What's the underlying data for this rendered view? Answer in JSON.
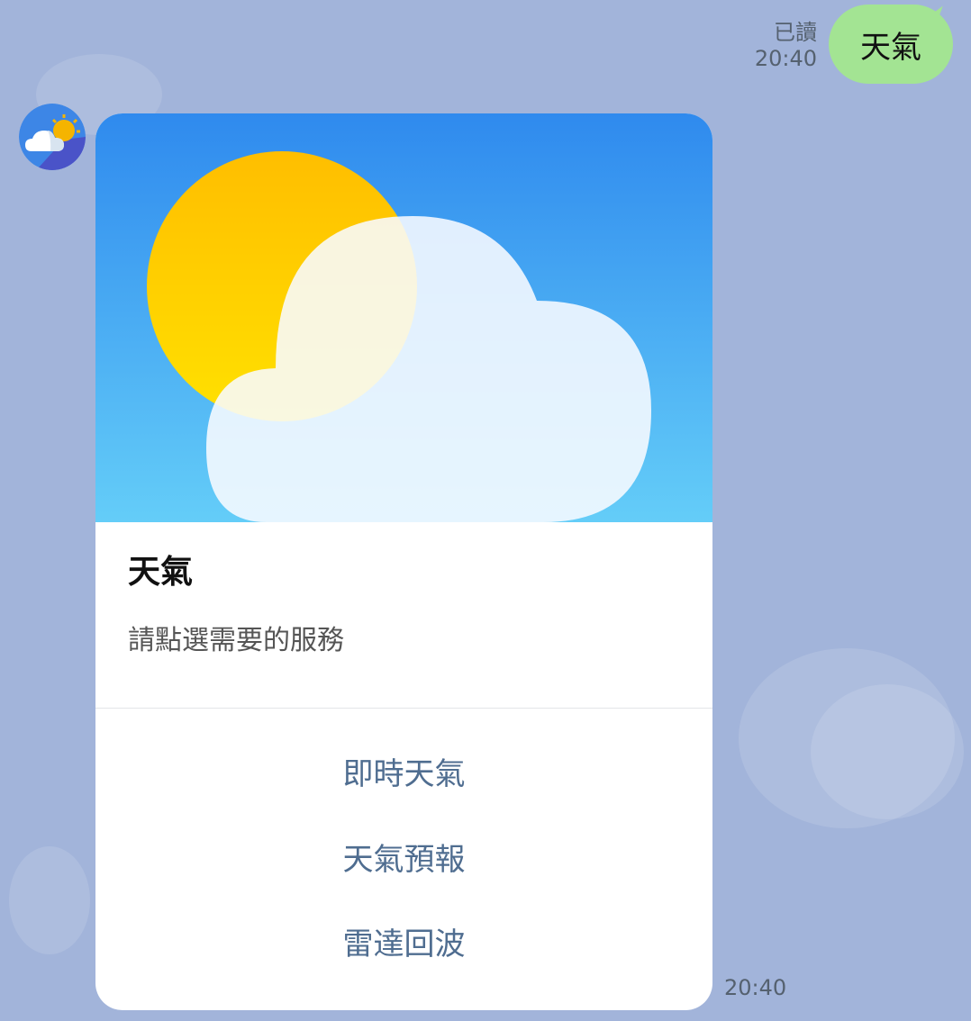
{
  "outgoing": {
    "read_label": "已讀",
    "time": "20:40",
    "text": "天氣"
  },
  "incoming": {
    "card": {
      "title": "天氣",
      "subtitle": "請點選需要的服務",
      "actions": [
        "即時天氣",
        "天氣預報",
        "雷達回波"
      ]
    },
    "time": "20:40"
  },
  "colors": {
    "chat_background": "#a2b4da",
    "outgoing_bubble": "#a3e493",
    "action_text": "#4f6d90",
    "sky_top": "#2f8aee",
    "sky_bottom": "#64cdf8",
    "sun_top": "#ffbe00",
    "sun_bottom": "#ffe100"
  },
  "icons": {
    "avatar": "weather-partly-cloudy-icon",
    "hero": "sun-behind-cloud-illustration"
  }
}
